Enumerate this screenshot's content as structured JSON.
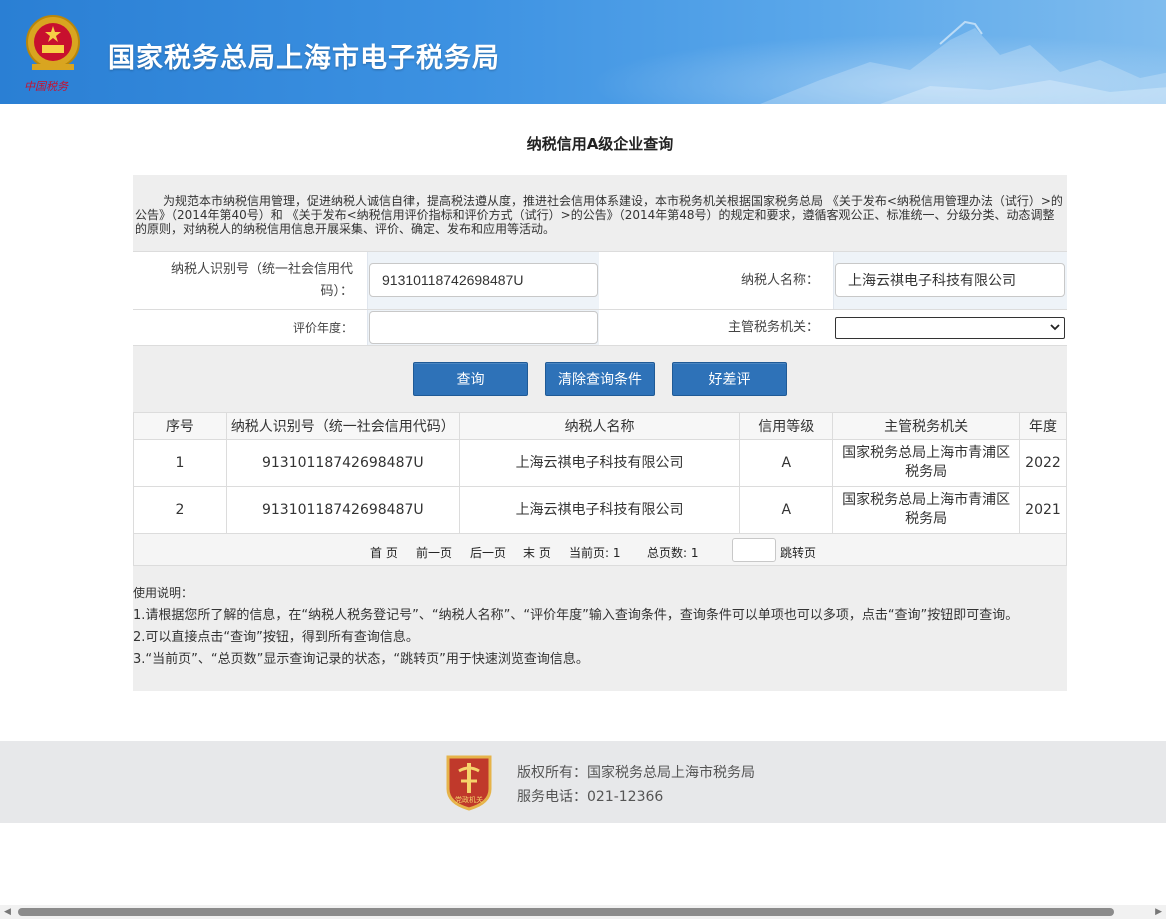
{
  "header": {
    "site_title": "国家税务总局上海市电子税务局",
    "emblem_icon": "national-tax-emblem-icon",
    "brand_color": "#2a7fd4"
  },
  "main": {
    "page_title": "纳税信用A级企业查询",
    "intro": "为规范本市纳税信用管理，促进纳税人诚信自律，提高税法遵从度，推进社会信用体系建设，本市税务机关根据国家税务总局 《关于发布<纳税信用管理办法（试行）>的公告》（2014年第40号）和 《关于发布<纳税信用评价指标和评价方式（试行）>的公告》（2014年第48号）的规定和要求，遵循客观公正、标准统一、分级分类、动态调整的原则，对纳税人的纳税信用信息开展采集、评价、确定、发布和应用等活动。"
  },
  "form": {
    "taxpayer_id_label": "纳税人识别号（统一社会信用代码）：",
    "taxpayer_id_value": "91310118742698487U",
    "taxpayer_name_label": "纳税人名称：",
    "taxpayer_name_value": "上海云祺电子科技有限公司",
    "year_label": "评价年度：",
    "year_value": "",
    "authority_label": "主管税务机关：",
    "authority_value": ""
  },
  "buttons": {
    "query": "查询",
    "clear": "清除查询条件",
    "feedback": "好差评"
  },
  "table": {
    "headers": [
      "序号",
      "纳税人识别号（统一社会信用代码）",
      "纳税人名称",
      "信用等级",
      "主管税务机关",
      "年度"
    ],
    "rows": [
      [
        "1",
        "91310118742698487U",
        "上海云祺电子科技有限公司",
        "A",
        "国家税务总局上海市青浦区税务局",
        "2022"
      ],
      [
        "2",
        "91310118742698487U",
        "上海云祺电子科技有限公司",
        "A",
        "国家税务总局上海市青浦区税务局",
        "2021"
      ]
    ]
  },
  "pager": {
    "first": "首 页",
    "prev": "前一页",
    "next": "后一页",
    "last": "末 页",
    "current_page_text": "当前页: 1",
    "total_pages_text": "总页数: 1",
    "jump": "跳转页"
  },
  "usage": {
    "title": "使用说明：",
    "items": [
      "1.请根据您所了解的信息，在“纳税人税务登记号”、“纳税人名称”、“评价年度”输入查询条件，查询条件可以单项也可以多项，点击“查询”按钮即可查询。",
      "2.可以直接点击“查询”按钮，得到所有查询信息。",
      "3.“当前页”、“总页数”显示查询记录的状态，“跳转页”用于快速浏览查询信息。"
    ]
  },
  "footer": {
    "copyright": "版权所有：国家税务总局上海市税务局",
    "phone": "服务电话：021-12366",
    "badge_text": "党政机关",
    "badge_icon": "party-government-badge-icon"
  }
}
